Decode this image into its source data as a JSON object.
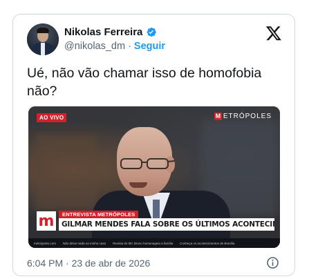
{
  "tweet": {
    "author_name": "Nikolas Ferreira",
    "handle": "@nikolas_dm",
    "separator": "·",
    "follow_label": "Seguir",
    "text": "Ué, não vão chamar isso de homofobia não?",
    "timestamp": "6:04 PM · 23 de abr de 2026"
  },
  "video": {
    "live_badge": "AO VIVO",
    "brand_initial": "M",
    "brand_name": "ETRÓPOLES",
    "lower_third": {
      "logo": "m",
      "tag": "ENTREVISTA METRÓPOLES",
      "headline": "GILMAR MENDES FALA SOBRE OS ÚLTIMOS ACONTECIMENTOS DO STF"
    },
    "ticker": [
      "metrópoles.com",
      "Não deixe nada na minha casa",
      "Revista do MC Bruno homenageia a família",
      "Conheça os acontecimentos de Brasília"
    ]
  },
  "icons": {
    "verified": "verified-badge-icon",
    "platform": "x-logo-icon",
    "info": "info-icon"
  },
  "colors": {
    "accent": "#1d9bf0",
    "brand_red": "#d4202a",
    "text_primary": "#0f1419",
    "text_secondary": "#536471"
  }
}
